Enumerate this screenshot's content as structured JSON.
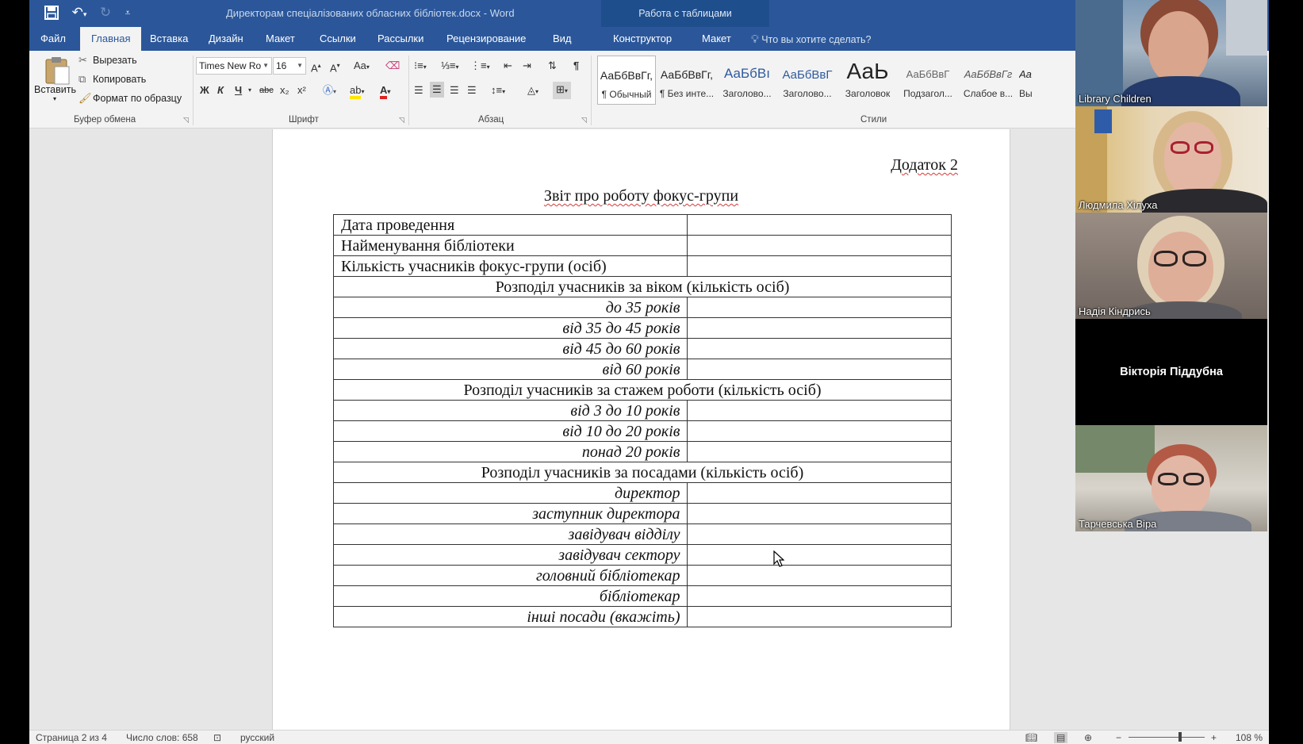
{
  "window": {
    "title": "Директорам спеціалізованих обласних бібліотек.docx - Word",
    "contextual_tab_group": "Работа с таблицами"
  },
  "tabs": [
    {
      "label": "Файл",
      "active": false
    },
    {
      "label": "Главная",
      "active": true
    },
    {
      "label": "Вставка",
      "active": false
    },
    {
      "label": "Дизайн",
      "active": false
    },
    {
      "label": "Макет",
      "active": false
    },
    {
      "label": "Ссылки",
      "active": false
    },
    {
      "label": "Рассылки",
      "active": false
    },
    {
      "label": "Рецензирование",
      "active": false
    },
    {
      "label": "Вид",
      "active": false
    },
    {
      "label": "Конструктор",
      "active": false
    },
    {
      "label": "Макет",
      "active": false
    }
  ],
  "tell_me": "Что вы хотите сделать?",
  "ribbon": {
    "clipboard": {
      "paste": "Вставить",
      "cut": "Вырезать",
      "copy": "Копировать",
      "format_painter": "Формат по образцу",
      "label": "Буфер обмена"
    },
    "font": {
      "name": "Times New Ro",
      "size": "16",
      "bold": "Ж",
      "italic": "К",
      "underline": "Ч",
      "strike": "abc",
      "subscript": "x₂",
      "superscript": "x²",
      "change_case": "Aa",
      "label": "Шрифт"
    },
    "paragraph": {
      "label": "Абзац"
    },
    "styles": {
      "items": [
        {
          "sample": "АаБбВвГг,",
          "name": "¶ Обычный",
          "selected": true
        },
        {
          "sample": "АаБбВвГг,",
          "name": "¶ Без инте...",
          "selected": false
        },
        {
          "sample": "АаБбВı",
          "name": "Заголово...",
          "selected": false
        },
        {
          "sample": "АаБбВвГ",
          "name": "Заголово...",
          "selected": false
        },
        {
          "sample": "АаЬ",
          "name": "Заголовок",
          "selected": false
        },
        {
          "sample": "АаБбВвГ",
          "name": "Подзагол...",
          "selected": false
        },
        {
          "sample": "АаБбВвГг",
          "name": "Слабое в...",
          "selected": false
        },
        {
          "sample": "Аа",
          "name": "Вы",
          "selected": false
        }
      ],
      "label": "Стили"
    }
  },
  "document": {
    "appendix": "Додаток 2",
    "heading": "Звіт про роботу фокус-групи",
    "rows": [
      {
        "label": "Дата проведення",
        "type": "plain"
      },
      {
        "label": "Найменування бібліотеки",
        "type": "plain"
      },
      {
        "label": "Кількість учасників фокус-групи (осіб)",
        "type": "plain"
      },
      {
        "label": "Розподіл учасників за віком (кількість осіб)",
        "type": "header"
      },
      {
        "label": "до 35 років",
        "type": "italic"
      },
      {
        "label": "від 35 до 45 років",
        "type": "italic"
      },
      {
        "label": "від 45 до 60 років",
        "type": "italic"
      },
      {
        "label": "від 60 років",
        "type": "italic"
      },
      {
        "label": "Розподіл учасників за стажем роботи (кількість осіб)",
        "type": "header"
      },
      {
        "label": "від 3 до 10 років",
        "type": "italic"
      },
      {
        "label": "від 10 до 20 років",
        "type": "italic"
      },
      {
        "label": "понад  20 років",
        "type": "italic"
      },
      {
        "label": "Розподіл учасників за посадами (кількість осіб)",
        "type": "header"
      },
      {
        "label": "директор",
        "type": "italic"
      },
      {
        "label": "заступник директора",
        "type": "italic"
      },
      {
        "label": "завідувач відділу",
        "type": "italic"
      },
      {
        "label": "завідувач сектору",
        "type": "italic"
      },
      {
        "label": "головний бібліотекар",
        "type": "italic"
      },
      {
        "label": "бібліотекар ",
        "type": "italic"
      },
      {
        "label": "інші посади (вкажіть)",
        "type": "italic"
      }
    ]
  },
  "statusbar": {
    "page": "Страница 2 из 4",
    "words": "Число слов: 658",
    "language": "русский",
    "zoom": "108 %"
  },
  "participants": [
    {
      "name": "Library Children",
      "video": true
    },
    {
      "name": "Людмила Хілуха",
      "video": true
    },
    {
      "name": "Надія Кіндрись",
      "video": true
    },
    {
      "name": "Вікторія Піддубна",
      "video": false
    },
    {
      "name": "Тарчевська Віра",
      "video": true
    }
  ],
  "colors": {
    "word_blue": "#2b579a",
    "ribbon_bg": "#f3f3f3",
    "spell_error": "#d43a3a"
  }
}
